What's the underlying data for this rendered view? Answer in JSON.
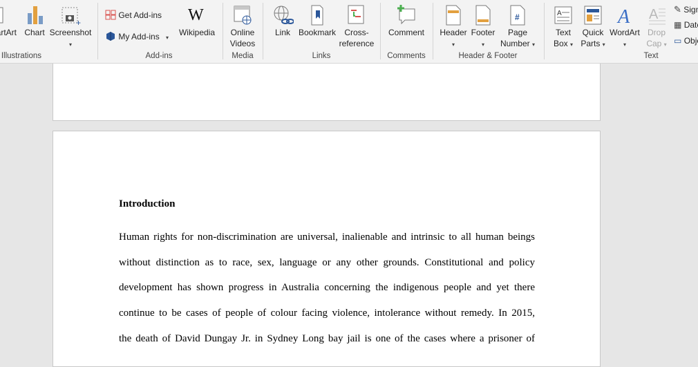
{
  "ribbon": {
    "illustrations": {
      "smartart_label": "SmartArt",
      "chart_label": "Chart",
      "screenshot_label": "Screenshot",
      "group_label": "Illustrations"
    },
    "addins": {
      "get_addins_label": "Get Add-ins",
      "my_addins_label": "My Add-ins",
      "wikipedia_label": "Wikipedia",
      "group_label": "Add-ins"
    },
    "media": {
      "online_videos_line1": "Online",
      "online_videos_line2": "Videos",
      "group_label": "Media"
    },
    "links": {
      "link_label": "Link",
      "bookmark_label": "Bookmark",
      "crossref_line1": "Cross-",
      "crossref_line2": "reference",
      "group_label": "Links"
    },
    "comments": {
      "comment_label": "Comment",
      "group_label": "Comments"
    },
    "header_footer": {
      "header_label": "Header",
      "footer_label": "Footer",
      "page_number_line1": "Page",
      "page_number_line2": "Number",
      "group_label": "Header & Footer"
    },
    "text": {
      "textbox_line1": "Text",
      "textbox_line2": "Box",
      "quickparts_line1": "Quick",
      "quickparts_line2": "Parts",
      "wordart_label": "WordArt",
      "dropcap_line1": "Drop",
      "dropcap_line2": "Cap",
      "signature_label": "Signature Line",
      "datetime_label": "Date & Time",
      "object_label": "Object",
      "group_label": "Text"
    }
  },
  "document": {
    "heading": "Introduction",
    "lines": [
      "Human rights for non-discrimination are universal, inalienable and intrinsic to all human beings",
      "without distinction as to race, sex, language or any other grounds. Constitutional and policy",
      "development has shown progress in Australia concerning the indigenous people and yet there",
      "continue to be cases of people of colour facing violence, intolerance without remedy. In 2015,",
      "the death of David Dungay Jr. in Sydney Long bay jail is one of the cases where a prisoner of"
    ]
  },
  "colors": {
    "ribbon_bg": "#f3f3f3",
    "workspace_bg": "#e6e6e6",
    "accent_blue": "#2b579a",
    "icon_orange": "#e2a03f",
    "icon_green": "#4caf50",
    "icon_red": "#d9534f"
  }
}
